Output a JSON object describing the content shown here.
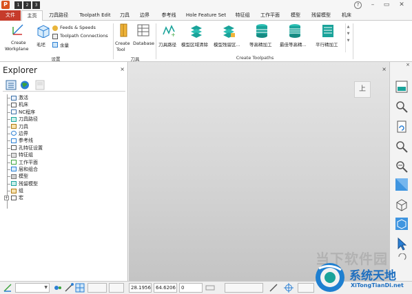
{
  "quick_access": {
    "logo_letter": "P",
    "buttons": [
      "1",
      "2",
      "3"
    ],
    "help_glyph": "?"
  },
  "tabs": [
    {
      "label": "文件",
      "kind": "file"
    },
    {
      "label": "主页",
      "kind": "active"
    },
    {
      "label": "刀具路径",
      "kind": "normal"
    },
    {
      "label": "Toolpath Edit",
      "kind": "normal"
    },
    {
      "label": "刀具",
      "kind": "normal"
    },
    {
      "label": "边界",
      "kind": "normal"
    },
    {
      "label": "参考线",
      "kind": "normal"
    },
    {
      "label": "Hole Feature Set",
      "kind": "normal"
    },
    {
      "label": "特征组",
      "kind": "normal"
    },
    {
      "label": "工作平面",
      "kind": "normal"
    },
    {
      "label": "模型",
      "kind": "normal"
    },
    {
      "label": "残留模型",
      "kind": "normal"
    },
    {
      "label": "机床",
      "kind": "normal"
    }
  ],
  "ribbon": {
    "setup": {
      "create_workplane": [
        "Create",
        "Workplane"
      ],
      "block": "毛坯",
      "feeds_speeds": "Feeds & Speeds",
      "toolpath_connections": "Toolpath Connections",
      "allowance": "余量",
      "group_label": "设置"
    },
    "tool": {
      "create_tool": [
        "Create",
        "Tool"
      ],
      "database": "Database",
      "group_label": "刀具"
    },
    "create_toolpaths": {
      "items": [
        "刀具路径",
        "模型区域清除",
        "模型残留区...",
        "等高精加工",
        "最佳等高精...",
        "平行精加工"
      ],
      "group_label": "Create Toolpaths"
    }
  },
  "explorer": {
    "title": "Explorer",
    "close": "×",
    "items": [
      {
        "label": "激活",
        "expandable": false
      },
      {
        "label": "机床",
        "expandable": false
      },
      {
        "label": "NC程序",
        "expandable": false
      },
      {
        "label": "刀具路径",
        "expandable": false
      },
      {
        "label": "刀具",
        "expandable": false
      },
      {
        "label": "边界",
        "expandable": false
      },
      {
        "label": "参考线",
        "expandable": false
      },
      {
        "label": "孔特征设置",
        "expandable": false
      },
      {
        "label": "特征组",
        "expandable": false
      },
      {
        "label": "工作平面",
        "expandable": false
      },
      {
        "label": "层和组合",
        "expandable": false
      },
      {
        "label": "模型",
        "expandable": false
      },
      {
        "label": "残留模型",
        "expandable": false
      },
      {
        "label": "组",
        "expandable": false
      },
      {
        "label": "宏",
        "expandable": true
      }
    ]
  },
  "viewport": {
    "close": "×",
    "viewcube_label": "上"
  },
  "statusbar": {
    "x": "28.1956",
    "y": "64.6206",
    "z": "0"
  },
  "watermark": {
    "faint_text": "当下软件园",
    "site_name": "系统天地",
    "site_url": "XiTongTianDi.net"
  },
  "colors": {
    "file_tab": "#c63b2b",
    "accent_blue": "#2a7fd4",
    "teal": "#1aa39a"
  }
}
